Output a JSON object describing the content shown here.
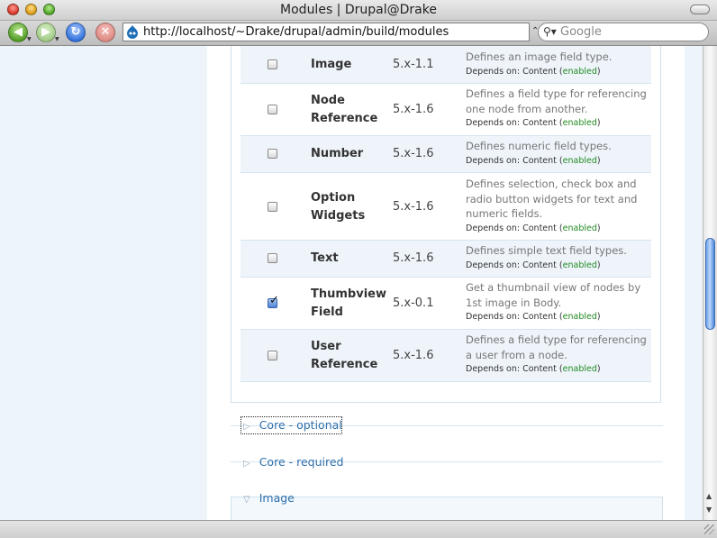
{
  "window": {
    "title": "Modules | Drupal@Drake"
  },
  "toolbar": {
    "url": "http://localhost/~Drake/drupal/admin/build/modules",
    "search_placeholder": "Google"
  },
  "modules": [
    {
      "name": "Image",
      "version": "5.x-1.1",
      "description": "Defines an image field type.",
      "depends_label": "Depends on: Content",
      "depends_status": "enabled",
      "checked": false
    },
    {
      "name": "Node Reference",
      "version": "5.x-1.6",
      "description": "Defines a field type for referencing one node from another.",
      "depends_label": "Depends on: Content",
      "depends_status": "enabled",
      "checked": false
    },
    {
      "name": "Number",
      "version": "5.x-1.6",
      "description": "Defines numeric field types.",
      "depends_label": "Depends on: Content",
      "depends_status": "enabled",
      "checked": false
    },
    {
      "name": "Option Widgets",
      "version": "5.x-1.6",
      "description": "Defines selection, check box and radio button widgets for text and numeric fields.",
      "depends_label": "Depends on: Content",
      "depends_status": "enabled",
      "checked": false
    },
    {
      "name": "Text",
      "version": "5.x-1.6",
      "description": "Defines simple text field types.",
      "depends_label": "Depends on: Content",
      "depends_status": "enabled",
      "checked": false
    },
    {
      "name": "Thumbview Field",
      "version": "5.x-0.1",
      "description": "Get a thumbnail view of nodes by 1st image in Body.",
      "depends_label": "Depends on: Content",
      "depends_status": "enabled",
      "checked": true
    },
    {
      "name": "User Reference",
      "version": "5.x-1.6",
      "description": "Defines a field type for referencing a user from a node.",
      "depends_label": "Depends on: Content",
      "depends_status": "enabled",
      "checked": false
    }
  ],
  "groups": {
    "core_optional": "Core - optional",
    "core_required": "Core - required",
    "image": "Image"
  },
  "colors": {
    "link": "#2f6fab",
    "enabled": "#228b22",
    "row_odd": "#eef4fa"
  }
}
